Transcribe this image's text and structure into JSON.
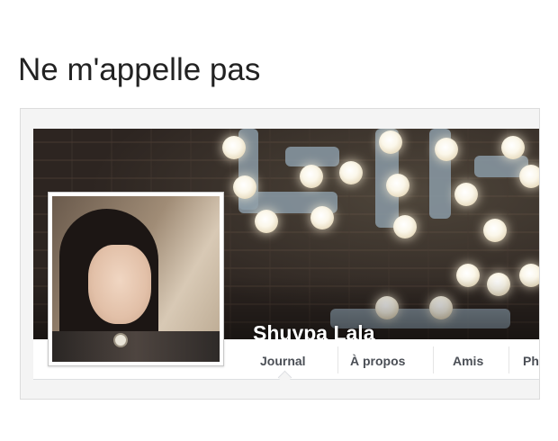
{
  "caption": "Ne m'appelle pas",
  "profile": {
    "name": "Shuypa Lala"
  },
  "nav": {
    "tabs": [
      "Journal",
      "À propos",
      "Amis",
      "Ph"
    ]
  },
  "colors": {
    "name_text": "#ffffff",
    "tab_text": "#4b4f56",
    "frame_bg": "#f4f4f4"
  }
}
